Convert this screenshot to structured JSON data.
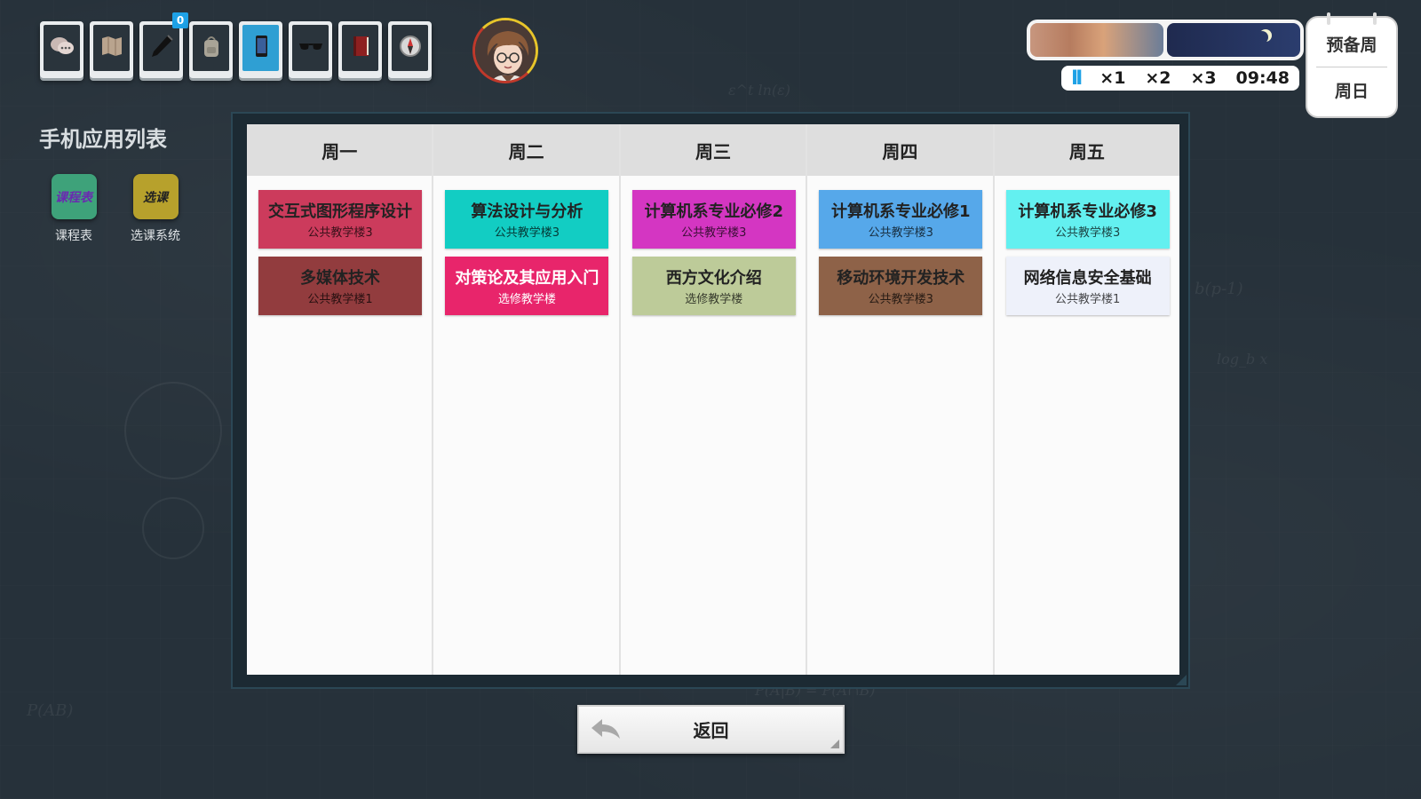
{
  "toolbar": {
    "tools": [
      {
        "icon": "chat-bubbles-icon"
      },
      {
        "icon": "map-icon"
      },
      {
        "icon": "pen-icon",
        "badge": "0"
      },
      {
        "icon": "backpack-icon"
      },
      {
        "icon": "phone-icon",
        "active": true
      },
      {
        "icon": "glasses-icon"
      },
      {
        "icon": "book-icon"
      },
      {
        "icon": "compass-icon"
      }
    ]
  },
  "time_panel": {
    "speeds": [
      "×1",
      "×2",
      "×3"
    ],
    "pause_symbol": "II",
    "time": "09:48",
    "week_label": "预备周",
    "day_label": "周日"
  },
  "apps_panel": {
    "title": "手机应用列表",
    "apps": [
      {
        "icon_text": "课程表",
        "label": "课程表",
        "color": "#3ea27a",
        "text_color": "#6a2ab0"
      },
      {
        "icon_text": "选课",
        "label": "选课系统",
        "color": "#b7a12c",
        "text_color": "#222222"
      }
    ]
  },
  "schedule": {
    "days": [
      {
        "label": "周一",
        "courses": [
          {
            "name": "交互式图形程序设计",
            "room": "公共教学楼3",
            "color": "#cc3b5c",
            "dark": false
          },
          {
            "name": "多媒体技术",
            "room": "公共教学楼1",
            "color": "#923c3e",
            "dark": false
          }
        ]
      },
      {
        "label": "周二",
        "courses": [
          {
            "name": "算法设计与分析",
            "room": "公共教学楼3",
            "color": "#12cdc3",
            "dark": false
          },
          {
            "name": "对策论及其应用入门",
            "room": "选修教学楼",
            "color": "#e8256b",
            "dark": true
          }
        ]
      },
      {
        "label": "周三",
        "courses": [
          {
            "name": "计算机系专业必修2",
            "room": "公共教学楼3",
            "color": "#d436c2",
            "dark": false
          },
          {
            "name": "西方文化介绍",
            "room": "选修教学楼",
            "color": "#bdcb99",
            "dark": false
          }
        ]
      },
      {
        "label": "周四",
        "courses": [
          {
            "name": "计算机系专业必修1",
            "room": "公共教学楼3",
            "color": "#56a8ea",
            "dark": false
          },
          {
            "name": "移动环境开发技术",
            "room": "公共教学楼3",
            "color": "#8e6248",
            "dark": false
          }
        ]
      },
      {
        "label": "周五",
        "courses": [
          {
            "name": "计算机系专业必修3",
            "room": "公共教学楼3",
            "color": "#63f0f0",
            "dark": false
          },
          {
            "name": "网络信息安全基础",
            "room": "公共教学楼1",
            "color": "#eef1fa",
            "dark": false
          }
        ]
      }
    ]
  },
  "back_button": {
    "label": "返回"
  }
}
